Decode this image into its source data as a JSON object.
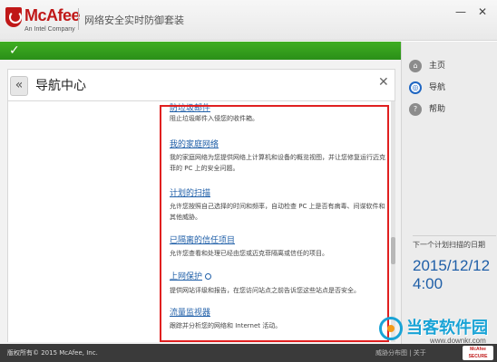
{
  "window": {
    "brand": "McAfee",
    "brand_sub": "An Intel Company",
    "title": "网络安全实时防御套装",
    "minimize_glyph": "—",
    "close_glyph": "✕"
  },
  "status": {
    "check_glyph": "✓",
    "color": "#2e9a1c"
  },
  "right_nav": {
    "items": [
      {
        "label": "主页",
        "icon": "home-icon",
        "glyph": "⌂"
      },
      {
        "label": "导航",
        "icon": "compass-icon",
        "glyph": "◎"
      },
      {
        "label": "帮助",
        "icon": "help-icon",
        "glyph": "?"
      }
    ],
    "schedule": {
      "label": "下一个计划扫描的日期",
      "date": "2015/12/12",
      "time": "4:00"
    }
  },
  "page": {
    "back_glyph": "«",
    "title": "导航中心",
    "close_glyph": "✕"
  },
  "items": [
    {
      "title": "防垃圾邮件",
      "desc": "阻止垃圾邮件入侵您的收件箱。"
    },
    {
      "title": "我的家庭网络",
      "desc": "我的家庭网络为您提供网络上计算机和设备的概览视图，并让您修复运行迈克菲的 PC 上的安全问题。"
    },
    {
      "title": "计划的扫描",
      "desc": "允许您按照自己选择的时间和频率，自动检查 PC 上是否有病毒、间谍软件和其他威胁。"
    },
    {
      "title": "已隔离的信任项目",
      "desc": "允许您查看和处理已经由您或迈克菲隔离或信任的项目。"
    },
    {
      "title": "上网保护",
      "desc": "提供网站评级和报告，在您访问站点之前告诉您这些站点是否安全。"
    },
    {
      "title": "流量监视器",
      "desc": "跟踪并分析您的网络和 Internet 活动。"
    }
  ],
  "footer": {
    "copyright": "版权所有© 2015 McAfee, Inc.",
    "links": "威胁分布图 | 关于",
    "secure_badge": "McAfee SECURE"
  },
  "watermark": {
    "text": "当客软件园",
    "url": "www.downkr.com"
  },
  "colors": {
    "accent_red": "#c01818",
    "link_blue": "#1f5fa8",
    "highlight_red": "#e02020"
  }
}
